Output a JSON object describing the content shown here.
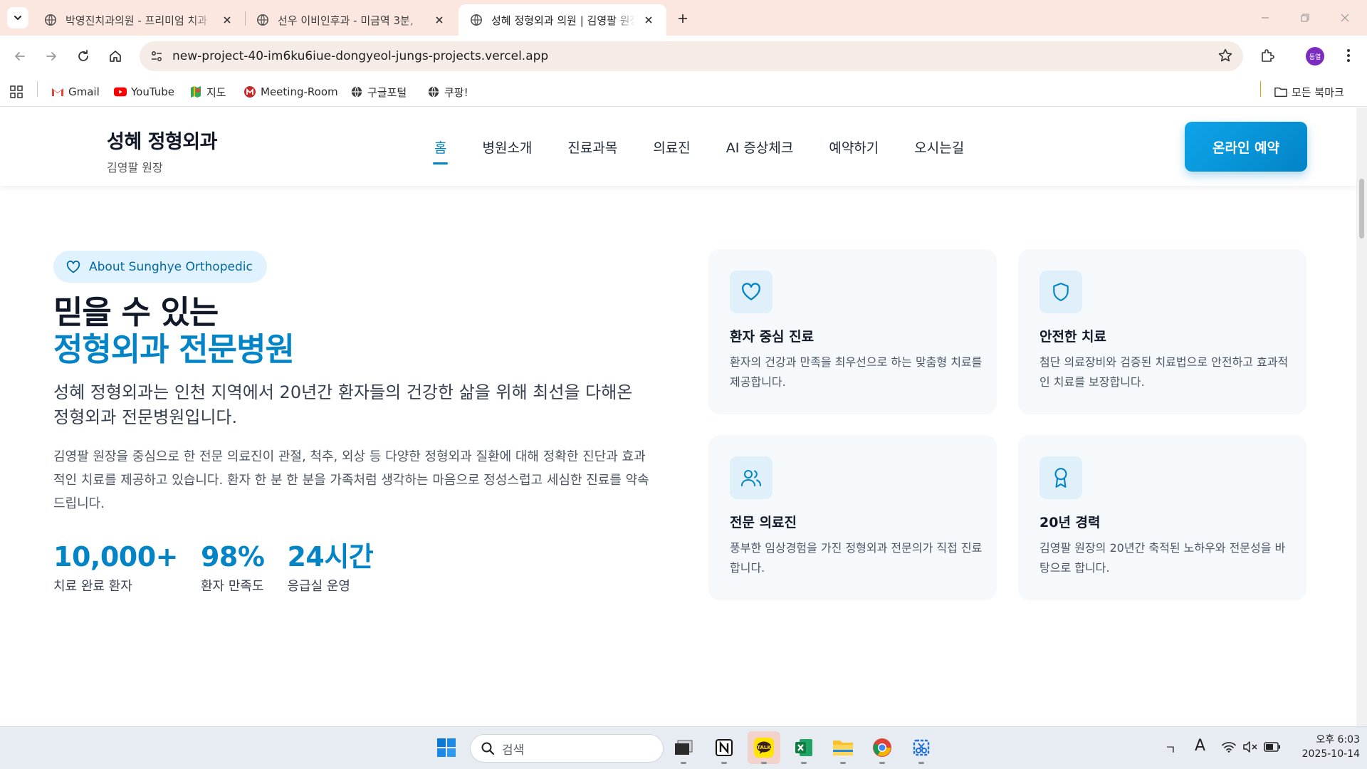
{
  "browser": {
    "tabs": [
      {
        "title": "박영진치과의원 - 프리미엄 치과"
      },
      {
        "title": "선우 이비인후과 - 미금역 3분,"
      },
      {
        "title": "성혜 정형외과 의원 | 김영팔 원장"
      }
    ],
    "active_tab_index": 2,
    "url": "new-project-40-im6ku6iue-dongyeol-jungs-projects.vercel.app",
    "profile_initial": "동열",
    "bookmarks": [
      {
        "label": "Gmail",
        "icon": "gmail-icon"
      },
      {
        "label": "YouTube",
        "icon": "youtube-icon"
      },
      {
        "label": "지도",
        "icon": "maps-icon"
      },
      {
        "label": "Meeting-Room",
        "icon": "meeting-room-icon"
      },
      {
        "label": "구글포털",
        "icon": "globe-icon"
      },
      {
        "label": "쿠팡!",
        "icon": "globe-icon"
      }
    ],
    "all_bookmarks_label": "모든 북마크"
  },
  "site": {
    "brand_name": "성혜 정형외과",
    "brand_sub": "김영팔 원장",
    "nav": [
      "홈",
      "병원소개",
      "진료과목",
      "의료진",
      "AI 증상체크",
      "예약하기",
      "오시는길"
    ],
    "nav_active_index": 0,
    "reserve_label": "온라인 예약",
    "accent_color": "#0284c7"
  },
  "about": {
    "badge": "About Sunghye Orthopedic",
    "title_line1": "믿을 수 있는",
    "title_line2": "정형외과 전문병원",
    "lead": "성혜 정형외과는 인천 지역에서 20년간 환자들의 건강한 삶을 위해 최선을 다해온 정형외과 전문병원입니다.",
    "description": "김영팔 원장을 중심으로 한 전문 의료진이 관절, 척추, 외상 등 다양한 정형외과 질환에 대해 정확한 진단과 효과적인 치료를 제공하고 있습니다. 환자 한 분 한 분을 가족처럼 생각하는 마음으로 정성스럽고 세심한 진료를 약속드립니다.",
    "stats": [
      {
        "value": "10,000+",
        "label": "치료 완료 환자"
      },
      {
        "value": "98%",
        "label": "환자 만족도"
      },
      {
        "value": "24시간",
        "label": "응급실 운영"
      }
    ]
  },
  "features": [
    {
      "icon": "heart-icon",
      "title": "환자 중심 진료",
      "text": "환자의 건강과 만족을 최우선으로 하는 맞춤형 치료를 제공합니다."
    },
    {
      "icon": "shield-icon",
      "title": "안전한 치료",
      "text": "첨단 의료장비와 검증된 치료법으로 안전하고 효과적인 치료를 보장합니다."
    },
    {
      "icon": "users-icon",
      "title": "전문 의료진",
      "text": "풍부한 임상경험을 가진 정형외과 전문의가 직접 진료합니다."
    },
    {
      "icon": "award-icon",
      "title": "20년 경력",
      "text": "김영팔 원장의 20년간 축적된 노하우와 전문성을 바탕으로 합니다."
    }
  ],
  "taskbar": {
    "search_placeholder": "검색",
    "tray_ime": "ㄱ",
    "tray_font": "A",
    "clock_time": "오후 6:03",
    "clock_date": "2025-10-14"
  }
}
